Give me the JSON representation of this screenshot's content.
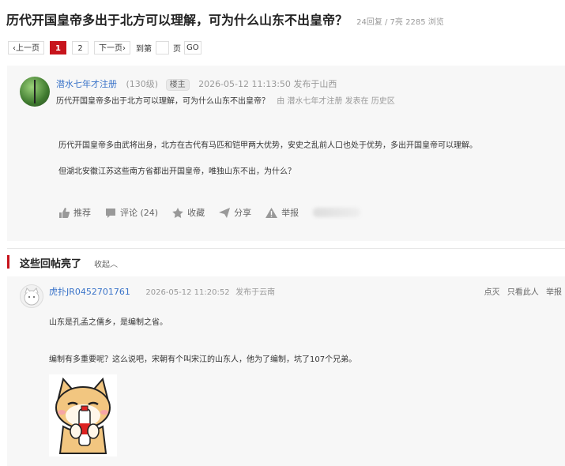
{
  "thread": {
    "title": "历代开国皇帝多出于北方可以理解，可为什么山东不出皇帝？",
    "stats": "24回复 / 7亮 2285 浏览"
  },
  "pager": {
    "prev": "上一页",
    "pages": [
      "1",
      "2"
    ],
    "current": "1",
    "next": "下一页",
    "goto_prefix": "到第",
    "goto_suffix": "页",
    "go": "GO"
  },
  "main_post": {
    "author": "潜水七年才注册",
    "level": "(130级)",
    "badge": "楼主",
    "time": "2026-05-12 11:13:50",
    "location": "发布于山西",
    "quote_title": "历代开国皇帝多出于北方可以理解，可为什么山东不出皇帝？",
    "by_label": "由",
    "by_author": "潜水七年才注册",
    "posted_in": "发表在",
    "board": "历史区",
    "paragraphs": [
      "历代开国皇帝多由武将出身，北方在古代有马匹和铠甲两大优势，安史之乱前人口也处于优势，多出开国皇帝可以理解。",
      "但湖北安徽江苏这些南方省都出开国皇帝，唯独山东不出，为什么？"
    ],
    "actions": {
      "recommend": "推荐",
      "comment": "评论 (24)",
      "favorite": "收藏",
      "share": "分享",
      "report": "举报"
    }
  },
  "highlights": {
    "title": "这些回帖亮了",
    "fold": "收起"
  },
  "reply": {
    "author": "虎扑JR0452701761",
    "time": "2026-05-12 11:20:52",
    "location": "发布于云南",
    "ops": [
      "点灭",
      "只看此人",
      "举报"
    ],
    "lines": [
      "山东是孔孟之儒乡，是编制之省。",
      "编制有多重要呢？这么说吧，宋朝有个叫宋江的山东人，他为了编制，坑了107个兄弟。"
    ]
  },
  "colors": {
    "accent": "#c7141c",
    "link": "#3b74c9",
    "panel": "#f7f7f7"
  }
}
